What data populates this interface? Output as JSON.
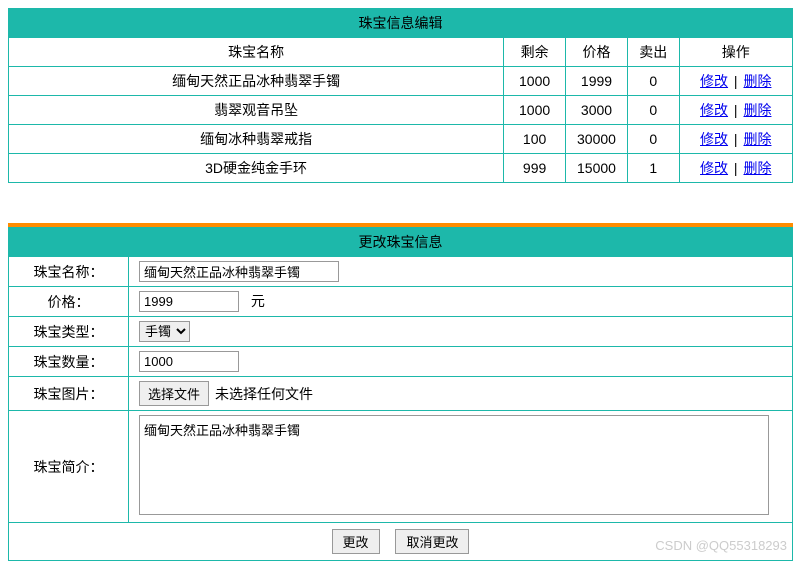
{
  "list_table": {
    "title": "珠宝信息编辑",
    "headers": {
      "name": "珠宝名称",
      "remain": "剩余",
      "price": "价格",
      "sold": "卖出",
      "action": "操作"
    },
    "action_edit": "修改",
    "action_delete": "删除",
    "rows": [
      {
        "name": "缅甸天然正品冰种翡翠手镯",
        "remain": "1000",
        "price": "1999",
        "sold": "0"
      },
      {
        "name": "翡翠观音吊坠",
        "remain": "1000",
        "price": "3000",
        "sold": "0"
      },
      {
        "name": "缅甸冰种翡翠戒指",
        "remain": "100",
        "price": "30000",
        "sold": "0"
      },
      {
        "name": "3D硬金纯金手环",
        "remain": "999",
        "price": "15000",
        "sold": "1"
      }
    ]
  },
  "form": {
    "title": "更改珠宝信息",
    "labels": {
      "name": "珠宝名称：",
      "price": "价格：",
      "type": "珠宝类型：",
      "qty": "珠宝数量：",
      "image": "珠宝图片：",
      "desc": "珠宝简介："
    },
    "price_unit": "元",
    "values": {
      "name": "缅甸天然正品冰种翡翠手镯",
      "price": "1999",
      "type_selected": "手镯",
      "qty": "1000",
      "desc": "缅甸天然正品冰种翡翠手镯"
    },
    "file": {
      "button": "选择文件",
      "status": "未选择任何文件"
    },
    "buttons": {
      "submit": "更改",
      "cancel": "取消更改"
    }
  },
  "watermark": "CSDN @QQ55318293"
}
